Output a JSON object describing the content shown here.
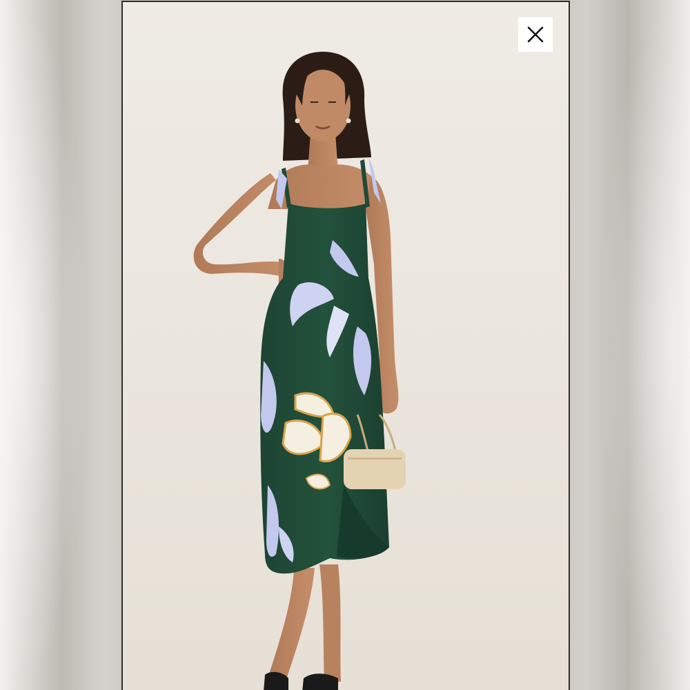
{
  "viewer": {
    "close_icon": "close-icon",
    "photo_subject": "product-photo"
  },
  "colors": {
    "backdrop": "#cfccc6",
    "photo_background": "#ede8e1",
    "dress_green": "#1f4a36",
    "print_lilac": "#c3c8ee",
    "print_cream": "#f4efe0",
    "print_ochre": "#d8a24c",
    "bag": "#e4d3b2",
    "close_button_bg": "#ffffff"
  }
}
